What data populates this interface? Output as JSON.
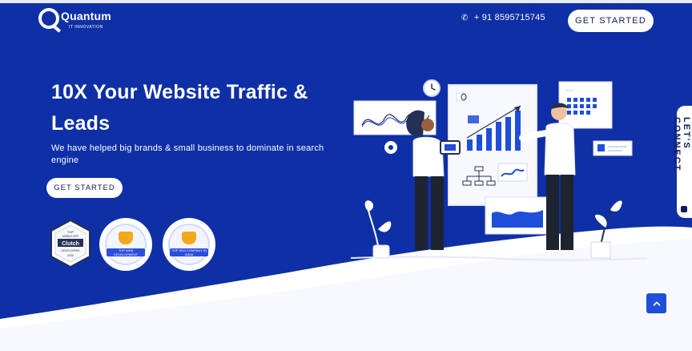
{
  "brand": {
    "name": "Quantum",
    "tagline": "IT INNOVATION"
  },
  "header": {
    "phone": "+ 91 8595715745",
    "cta": "GET STARTED"
  },
  "hero": {
    "title": "10X Your Website Traffic & Leads",
    "subtitle": "We have helped big brands & small business to dominate in search engine",
    "cta": "GET STARTED"
  },
  "badges": {
    "clutch": {
      "top": "TOP",
      "line1": "MOBILE APP",
      "brand": "Clutch",
      "line2": "DEVELOPERS",
      "year": "2020"
    },
    "award1": {
      "title": "TOP WEB DEVELOPMENT COMPANY IN INDIA"
    },
    "award2": {
      "title": "TOP SEO COMPANY IN INDIA"
    }
  },
  "side_tab": {
    "label": "LET'S CONNECT"
  },
  "icons": {
    "phone": "phone-icon",
    "back_to_top": "chevron-up-icon"
  },
  "colors": {
    "primary": "#0f2fa6",
    "accent": "#1f4ed8",
    "white": "#ffffff"
  }
}
